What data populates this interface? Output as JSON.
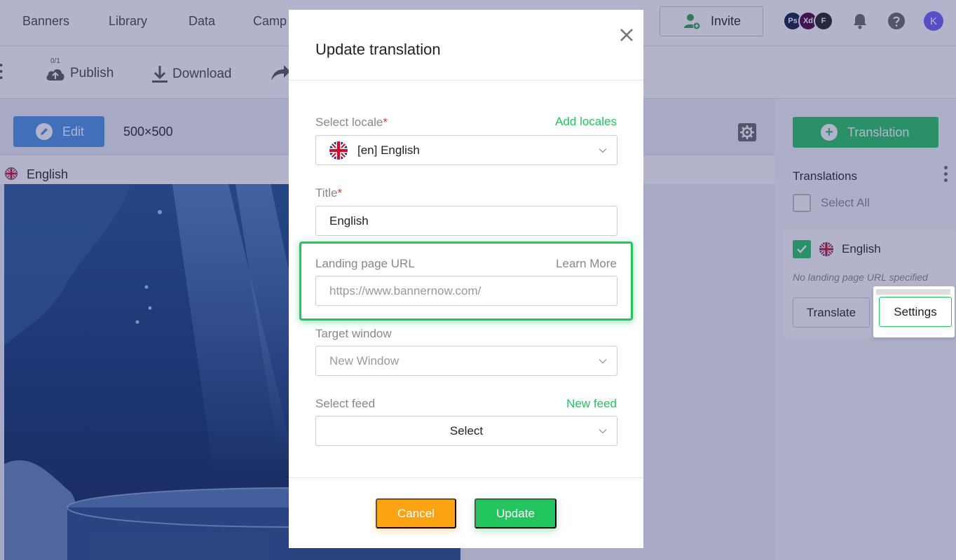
{
  "topnav": {
    "items": [
      "Banners",
      "Library",
      "Data",
      "Camp"
    ],
    "invite_label": "Invite",
    "apps": [
      {
        "name": "photoshop-icon",
        "label": "Ps",
        "color": "#0b1b3d"
      },
      {
        "name": "xd-icon",
        "label": "Xd",
        "color": "#470137"
      },
      {
        "name": "figma-icon",
        "label": "F",
        "color": "#1e1e1e"
      }
    ],
    "avatar_initial": "K"
  },
  "toolbar": {
    "publish_count": "0/1",
    "publish_label": "Publish",
    "download_label": "Download"
  },
  "canvas": {
    "edit_label": "Edit",
    "size": "500×500",
    "preview_locale": "English"
  },
  "right_panel": {
    "add_translation_label": "Translation",
    "translations_heading": "Translations",
    "select_all_label": "Select All",
    "item": {
      "label": "English",
      "checked": true,
      "note": "No landing page URL specified",
      "translate_label": "Translate",
      "settings_label": "Settings"
    }
  },
  "modal": {
    "title": "Update translation",
    "locale": {
      "label": "Select locale",
      "required": "*",
      "link": "Add locales",
      "value": "[en] English"
    },
    "title_field": {
      "label": "Title",
      "required": "*",
      "value": "English"
    },
    "landing_url": {
      "label": "Landing page URL",
      "link": "Learn More",
      "placeholder": "https://www.bannernow.com/"
    },
    "target_window": {
      "label": "Target window",
      "value": "New Window"
    },
    "feed": {
      "label": "Select feed",
      "link": "New feed",
      "value": "Select"
    },
    "cancel_label": "Cancel",
    "update_label": "Update"
  },
  "colors": {
    "accent_green": "#22c55e",
    "accent_blue": "#4a90e2",
    "cancel_orange": "#fca311",
    "overlay": "rgba(56,58,120,0.38)"
  }
}
